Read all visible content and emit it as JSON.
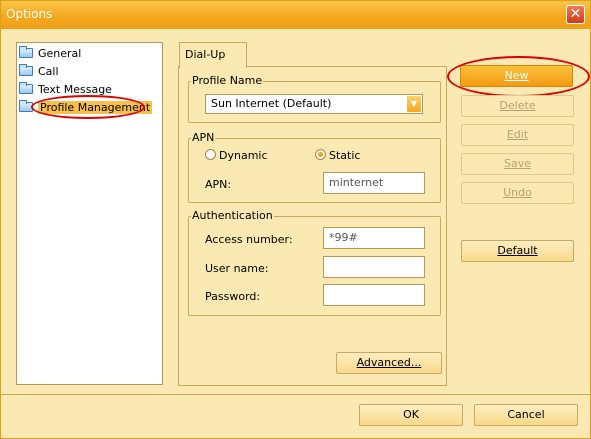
{
  "window": {
    "title": "Options"
  },
  "tree": {
    "items": [
      {
        "label": "General"
      },
      {
        "label": "Call"
      },
      {
        "label": "Text Message"
      },
      {
        "label": "Profile Management"
      }
    ]
  },
  "tabs": [
    {
      "label": "Dial-Up"
    }
  ],
  "profile": {
    "group_label": "Profile Name",
    "selected": "Sun Internet (Default)"
  },
  "apn": {
    "group_label": "APN",
    "dynamic_label": "Dynamic",
    "static_label": "Static",
    "selected": "Static",
    "apn_label": "APN:",
    "apn_value": "minternet"
  },
  "auth": {
    "group_label": "Authentication",
    "access_number_label": "Access number:",
    "access_number_value": "*99#",
    "username_label": "User name:",
    "username_value": "",
    "password_label": "Password:",
    "password_value": ""
  },
  "advanced_label": "Advanced...",
  "side_buttons": {
    "new": "New",
    "delete": "Delete",
    "edit": "Edit",
    "save": "Save",
    "undo": "Undo",
    "default": "Default"
  },
  "footer": {
    "ok": "OK",
    "cancel": "Cancel"
  },
  "colors": {
    "accent": "#f3a81f",
    "background": "#fbe9b4",
    "highlight_annotation": "#dc0000"
  }
}
